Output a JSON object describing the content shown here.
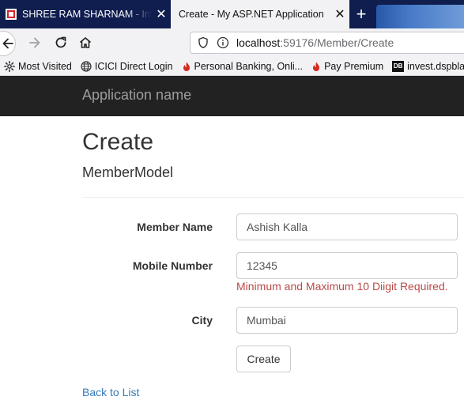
{
  "browser": {
    "tabs": [
      {
        "title": "SHREE RAM SHARNAM - Internet",
        "active": false,
        "close_glyph": "✕"
      },
      {
        "title": "Create - My ASP.NET Application",
        "active": true,
        "close_glyph": "✕"
      }
    ],
    "new_tab_glyph": "+",
    "url": {
      "host": "localhost",
      "rest": ":59176/Member/Create"
    },
    "bookmarks": [
      {
        "label": "Most Visited",
        "icon": "gear-icon"
      },
      {
        "label": "ICICI Direct Login",
        "icon": "globe-icon"
      },
      {
        "label": "Personal Banking, Onli...",
        "icon": "flame-icon"
      },
      {
        "label": "Pay Premium",
        "icon": "flame-icon"
      },
      {
        "label": "invest.dspblack",
        "icon": "db-icon",
        "icon_text": "DB"
      }
    ]
  },
  "app": {
    "brand": "Application name"
  },
  "page": {
    "title": "Create",
    "subtitle": "MemberModel"
  },
  "form": {
    "member_name": {
      "label": "Member Name",
      "value": "Ashish Kalla"
    },
    "mobile_number": {
      "label": "Mobile Number",
      "value": "12345",
      "error": "Minimum and Maximum 10 Diigit Required."
    },
    "city": {
      "label": "City",
      "value": "Mumbai"
    },
    "submit_label": "Create"
  },
  "footer": {
    "back_link": "Back to List"
  },
  "colors": {
    "tabstrip": "#0f1d4f",
    "app_navbar": "#222222",
    "brand_text": "#9d9d9d",
    "error": "#b94a48",
    "link": "#337ab7"
  }
}
